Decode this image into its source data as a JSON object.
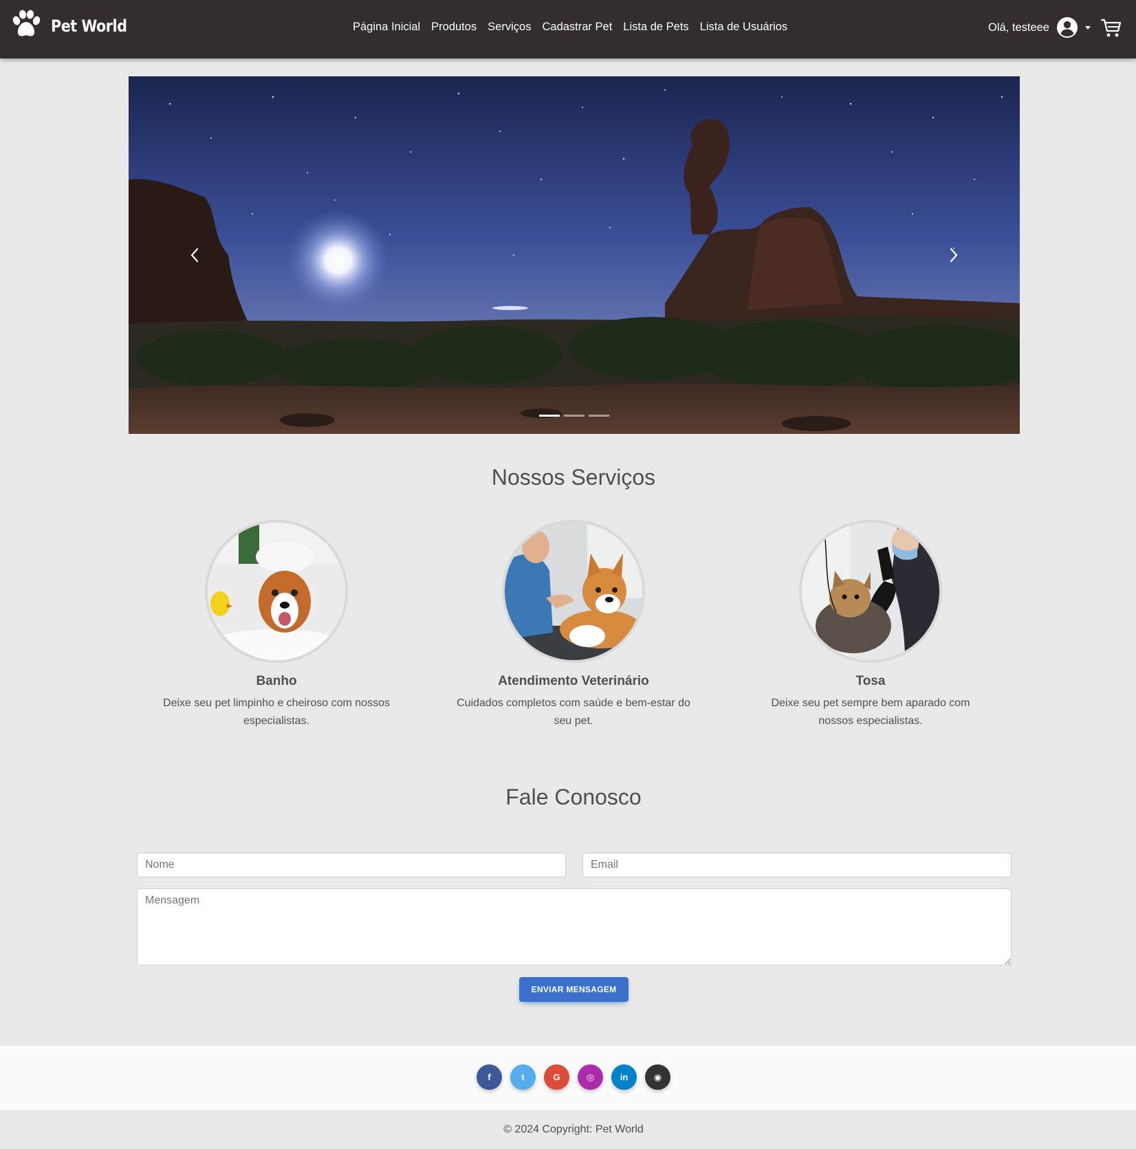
{
  "brand": {
    "name": "Pet World",
    "icon": "paw-icon"
  },
  "nav": {
    "links": [
      "Página Inicial",
      "Produtos",
      "Serviços",
      "Cadastrar Pet",
      "Lista de Pets",
      "Lista de Usuários"
    ]
  },
  "user": {
    "greeting": "Olá, testeee",
    "avatar_icon": "account-circle-icon",
    "cart_icon": "shopping-cart-icon"
  },
  "carousel": {
    "slide_count": 3,
    "active_index": 0
  },
  "services": {
    "title": "Nossos Serviços",
    "items": [
      {
        "title": "Banho",
        "description": "Deixe seu pet limpinho e cheiroso com nossos especialistas."
      },
      {
        "title": "Atendimento Veterinário",
        "description": "Cuidados completos com saúde e bem-estar do seu pet."
      },
      {
        "title": "Tosa",
        "description": "Deixe seu pet sempre bem aparado com nossos especialistas."
      }
    ]
  },
  "contact": {
    "title": "Fale Conosco",
    "name_placeholder": "Nome",
    "email_placeholder": "Email",
    "message_placeholder": "Mensagem",
    "submit_label": "ENVIAR MENSAGEM"
  },
  "footer": {
    "socials": [
      {
        "icon": "facebook-icon",
        "glyph": "f",
        "color": "#3b5998"
      },
      {
        "icon": "twitter-icon",
        "glyph": "t",
        "color": "#55acee"
      },
      {
        "icon": "google-icon",
        "glyph": "G",
        "color": "#dd4b39"
      },
      {
        "icon": "instagram-icon",
        "glyph": "◎",
        "color": "#ac2bac"
      },
      {
        "icon": "linkedin-icon",
        "glyph": "in",
        "color": "#0082ca"
      },
      {
        "icon": "github-icon",
        "glyph": "◉",
        "color": "#333333"
      }
    ],
    "copyright": "© 2024 Copyright: Pet World"
  }
}
